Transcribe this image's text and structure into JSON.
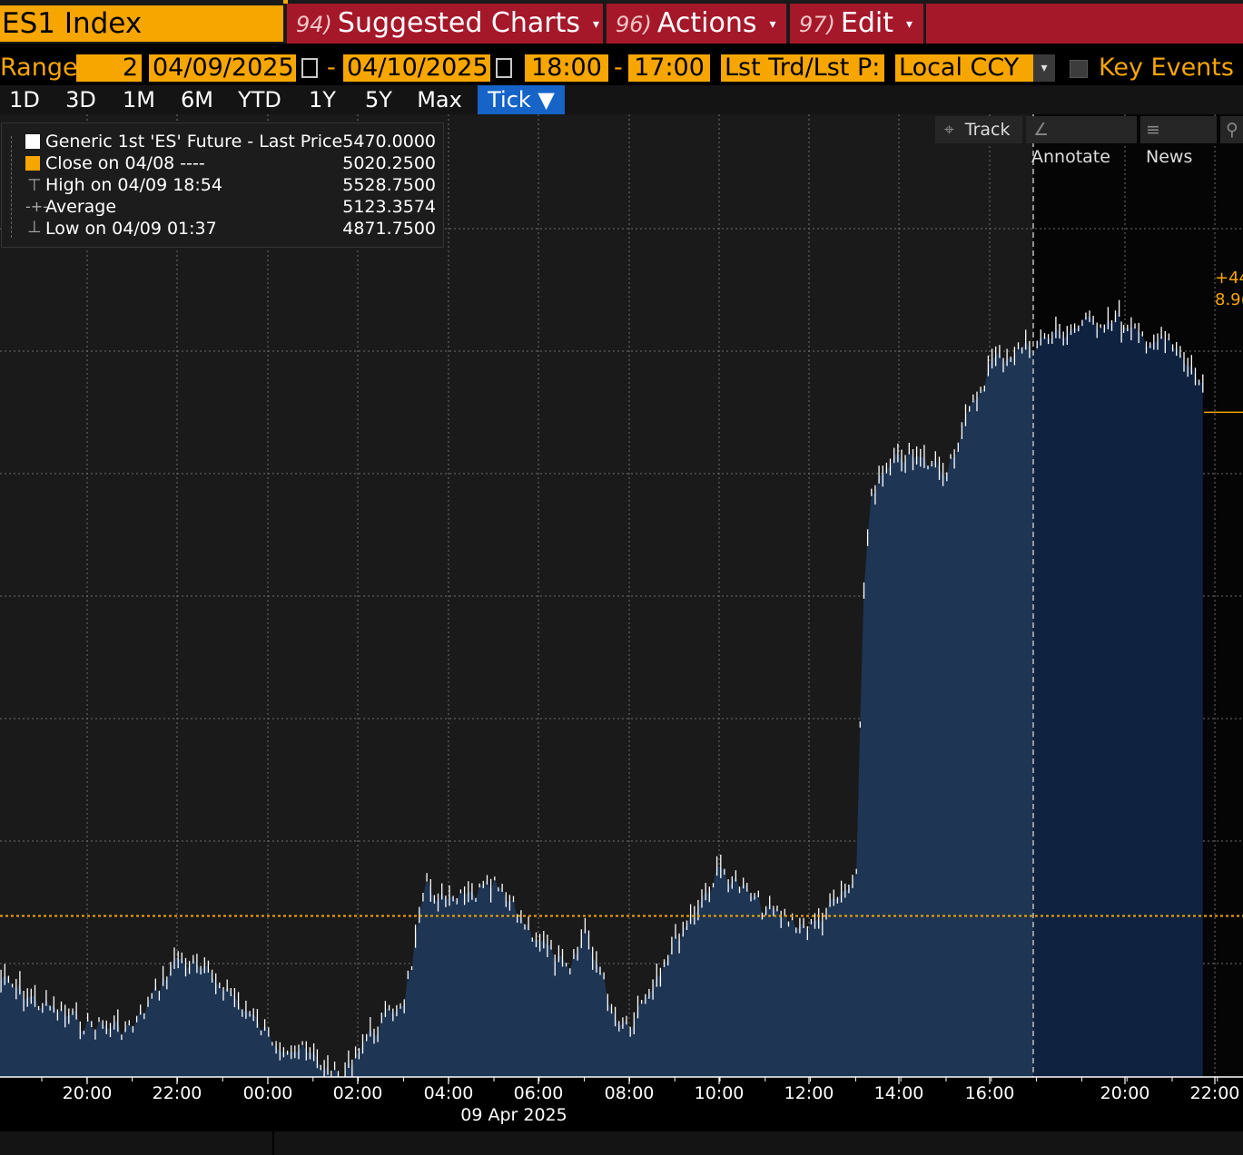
{
  "header": {
    "ticker": "ES1 Index",
    "menu": [
      {
        "num": "94)",
        "label": "Suggested Charts"
      },
      {
        "num": "96)",
        "label": "Actions"
      },
      {
        "num": "97)",
        "label": "Edit"
      }
    ],
    "caret": "▾"
  },
  "range": {
    "label": "Range",
    "count": "2",
    "start_date": "04/09/2025",
    "end_date": "04/10/2025",
    "start_time": "18:00",
    "end_time": "17:00",
    "dash": "-",
    "price_type": "Lst Trd/Lst P:",
    "currency": "Local CCY",
    "dropdown_caret": "▾",
    "key_events": "Key Events"
  },
  "periods": [
    "1D",
    "3D",
    "1M",
    "6M",
    "YTD",
    "1Y",
    "5Y",
    "Max"
  ],
  "active_period": "Tick ▼",
  "tools": {
    "track": "Track",
    "annotate": "Annotate",
    "news": "News"
  },
  "legend": [
    {
      "label": "Generic 1st 'ES' Future - Last Price",
      "value": "5470.0000"
    },
    {
      "label": "Close on 04/08 ----",
      "value": "5020.2500"
    },
    {
      "label": "High on 04/09 18:54",
      "value": "5528.7500"
    },
    {
      "label": "Average",
      "value": "5123.3574"
    },
    {
      "label": "Low on 04/09 01:37",
      "value": "4871.7500"
    }
  ],
  "last_price_tag": {
    "line1": "+44",
    "line2": "8.9("
  },
  "colors": {
    "orange": "#f7a600",
    "menu_red": "#a5182a",
    "area_fill": "#1e3554",
    "area_fill_next": "#0f2240",
    "active_tab": "#1664c8"
  },
  "chart_data": {
    "type": "area",
    "series": [
      {
        "name": "Generic 1st 'ES' Future - Last Price"
      }
    ],
    "x_tick_labels": [
      "20:00",
      "22:00",
      "00:00",
      "02:00",
      "04:00",
      "06:00",
      "08:00",
      "10:00",
      "12:00",
      "14:00",
      "16:00",
      "20:00",
      "22:00"
    ],
    "x_date_label": "09 Apr 2025",
    "reference_line": {
      "label": "Close on 04/08",
      "value": 5020.25
    },
    "x": [
      "18:00",
      "19:00",
      "20:00",
      "21:00",
      "22:00",
      "23:00",
      "00:00",
      "01:00",
      "01:37",
      "02:00",
      "03:00",
      "03:30",
      "04:00",
      "05:00",
      "06:00",
      "06:40",
      "07:00",
      "07:40",
      "08:00",
      "09:00",
      "10:00",
      "11:00",
      "12:00",
      "13:00",
      "13:10",
      "13:20",
      "14:00",
      "15:00",
      "16:00",
      "17:00",
      "18:00",
      "18:54",
      "19:00",
      "20:00",
      "21:00",
      "21:40"
    ],
    "y": [
      4968,
      4945,
      4928,
      4925,
      4985,
      4962,
      4918,
      4900,
      4880,
      4910,
      4950,
      5045,
      5030,
      5045,
      5000,
      4970,
      5010,
      4935,
      4930,
      5000,
      5060,
      5025,
      5010,
      5050,
      5300,
      5380,
      5410,
      5400,
      5490,
      5505,
      5520,
      5528,
      5515,
      5505,
      5460,
      5447
    ],
    "grid": true,
    "legend_position": "top-left"
  }
}
